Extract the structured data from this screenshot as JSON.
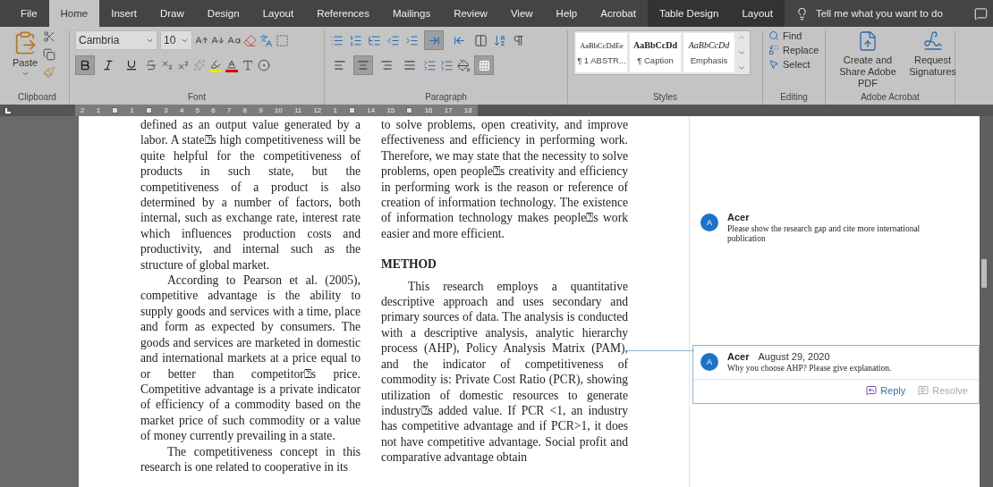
{
  "menu_tabs": [
    {
      "label": "File",
      "selected": false,
      "kind": "standard"
    },
    {
      "label": "Home",
      "selected": true,
      "kind": "standard"
    },
    {
      "label": "Insert",
      "selected": false,
      "kind": "standard"
    },
    {
      "label": "Draw",
      "selected": false,
      "kind": "standard"
    },
    {
      "label": "Design",
      "selected": false,
      "kind": "standard"
    },
    {
      "label": "Layout",
      "selected": false,
      "kind": "standard"
    },
    {
      "label": "References",
      "selected": false,
      "kind": "standard"
    },
    {
      "label": "Mailings",
      "selected": false,
      "kind": "standard"
    },
    {
      "label": "Review",
      "selected": false,
      "kind": "standard"
    },
    {
      "label": "View",
      "selected": false,
      "kind": "standard"
    },
    {
      "label": "Help",
      "selected": false,
      "kind": "standard"
    },
    {
      "label": "Acrobat",
      "selected": false,
      "kind": "standard"
    },
    {
      "label": "Table Design",
      "selected": false,
      "kind": "contextual"
    },
    {
      "label": "Layout",
      "selected": false,
      "kind": "contextual"
    }
  ],
  "tell_me": {
    "placeholder": "Tell me what you want to do"
  },
  "ribbon": {
    "clipboard": {
      "label": "Clipboard",
      "paste": "Paste"
    },
    "font": {
      "label": "Font",
      "family": "Cambria",
      "size": "10",
      "bold": true,
      "italic": false,
      "underline": false
    },
    "paragraph": {
      "label": "Paragraph",
      "direction": [
        {
          "kind": "ltr",
          "selected": true
        },
        {
          "kind": "rtl",
          "selected": false
        }
      ],
      "alignments": [
        {
          "kind": "left",
          "selected": false
        },
        {
          "kind": "center",
          "selected": true
        },
        {
          "kind": "right",
          "selected": false
        },
        {
          "kind": "justify",
          "selected": false
        }
      ]
    },
    "styles": {
      "label": "Styles",
      "items": [
        {
          "preview": "AaBbCcDdEe",
          "name": "¶ 1 ABSTR...",
          "kind": "plain"
        },
        {
          "preview": "AaBbCcDd",
          "name": "¶ Caption",
          "kind": "bold"
        },
        {
          "preview": "AaBbCcDd",
          "name": "Emphasis",
          "kind": "italic"
        }
      ]
    },
    "editing": {
      "label": "Editing",
      "items": [
        {
          "label": "Find",
          "kind": "find"
        },
        {
          "label": "Replace",
          "kind": "replace"
        },
        {
          "label": "Select",
          "kind": "select"
        }
      ]
    },
    "acrobat": {
      "label": "Adobe Acrobat",
      "items": [
        {
          "label": "Create and Share Adobe PDF",
          "kind": "pdf"
        },
        {
          "label": "Request Signatures",
          "kind": "sign"
        }
      ]
    }
  },
  "ruler": [
    {
      "kind": "number",
      "label": "2"
    },
    {
      "kind": "number",
      "label": "1"
    },
    {
      "kind": "marker"
    },
    {
      "kind": "number",
      "label": "1"
    },
    {
      "kind": "marker"
    },
    {
      "kind": "number",
      "label": "3"
    },
    {
      "kind": "number",
      "label": "4"
    },
    {
      "kind": "number",
      "label": "5"
    },
    {
      "kind": "number",
      "label": "6"
    },
    {
      "kind": "number",
      "label": "7"
    },
    {
      "kind": "number",
      "label": "8"
    },
    {
      "kind": "number",
      "label": "9"
    },
    {
      "kind": "number",
      "label": "10"
    },
    {
      "kind": "number",
      "label": "11"
    },
    {
      "kind": "number",
      "label": "12"
    },
    {
      "kind": "number",
      "label": "1"
    },
    {
      "kind": "marker"
    },
    {
      "kind": "number",
      "label": "14"
    },
    {
      "kind": "number",
      "label": "15"
    },
    {
      "kind": "marker"
    },
    {
      "kind": "number",
      "label": "16"
    },
    {
      "kind": "number",
      "label": "17"
    },
    {
      "kind": "number",
      "label": "18"
    }
  ],
  "document": {
    "columns": [
      [
        {
          "kind": "paragraph",
          "indent": false,
          "text": "defined as an output value generated by a labor. A state⍰s high competitiveness will be quite helpful for the competitiveness of products in such state, but the competitiveness of a product is also determined by a number of factors, both internal, such as exchange rate, interest rate which influences production costs and productivity, and internal such as the structure of global market."
        },
        {
          "kind": "paragraph",
          "indent": true,
          "text": "According to Pearson et al. (2005), competitive advantage is the ability to supply goods and services with a time, place and form as expected by consumers. The goods and services are marketed in domestic and international markets at a price equal to or better than competitor⍰s price. Competitive advantage is a private indicator of efficiency of a commodity based on the market price of such commodity or a value of money currently prevailing in a state."
        },
        {
          "kind": "paragraph",
          "indent": true,
          "text": "The competitiveness concept in this research is one related to cooperative in its"
        }
      ],
      [
        {
          "kind": "paragraph",
          "indent": false,
          "text": "to solve problems, open creativity, and improve effectiveness and efficiency in performing work. Therefore, we may state that the necessity to solve problems, open people⍰s creativity and efficiency in performing work is the reason or reference of creation of information technology. The existence of information technology makes people⍰s work easier and more efficient."
        },
        {
          "kind": "heading",
          "text": "METHOD"
        },
        {
          "kind": "paragraph",
          "indent": true,
          "text": "This research employs a quantitative descriptive approach and uses secondary and primary sources of data. The analysis is conducted with a descriptive analysis, analytic hierarchy process (AHP), Policy Analysis Matrix (PAM), and the indicator of competitiveness of commodity is: Private Cost Ratio (PCR), showing utilization of domestic resources to generate industry⍰s added value. If PCR <1, an industry has competitive advantage and if PCR>1, it does not have competitive advantage. Social profit and comparative advantage obtain"
        }
      ]
    ]
  },
  "comments": [
    {
      "avatar": "A",
      "author": "Acer",
      "text": "Please  show the research gap and cite more international publication",
      "selected": false
    },
    {
      "avatar": "A",
      "author": "Acer",
      "date": "August 29, 2020",
      "text": "Why you choose AHP? Please give explanation.",
      "selected": true,
      "actions": [
        {
          "label": "Reply",
          "disabled": false
        },
        {
          "label": "Resolve",
          "disabled": true
        }
      ]
    }
  ]
}
